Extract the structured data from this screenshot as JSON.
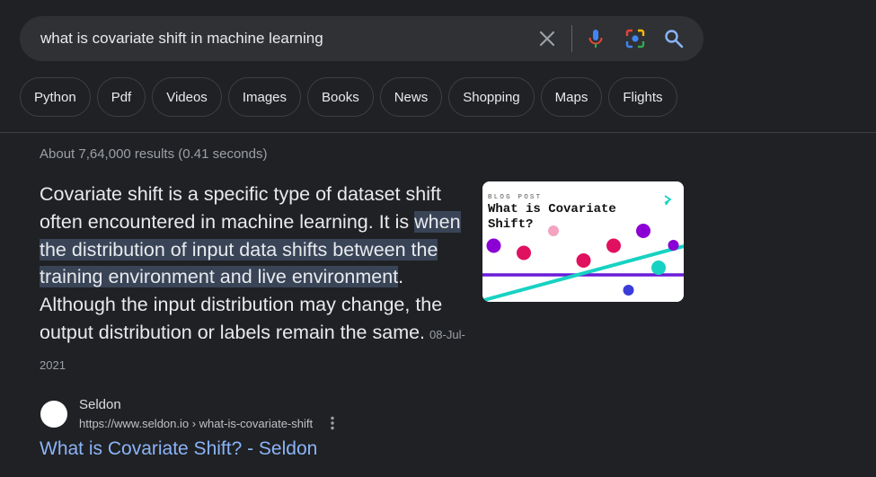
{
  "search": {
    "query": "what is covariate shift in machine learning",
    "icons": [
      "close-icon",
      "microphone-icon",
      "lens-icon",
      "search-icon"
    ]
  },
  "chips": [
    "Python",
    "Pdf",
    "Videos",
    "Images",
    "Books",
    "News",
    "Shopping",
    "Maps",
    "Flights"
  ],
  "stats": "About 7,64,000 results (0.41 seconds)",
  "snippet": {
    "text_before": "Covariate shift is a specific type of dataset shift often encountered in machine learning. It is ",
    "highlight": "when the distribution of input data shifts between the training environment and live environment",
    "text_after": ". Although the input distribution may change, the output distribution or labels remain the same.",
    "date": "08-Jul-2021"
  },
  "thumbnail": {
    "kicker": "BLOG POST",
    "title_line1": "What is Covariate",
    "title_line2": "Shift?",
    "colors": {
      "magenta": "#e0115f",
      "purple": "#8b00d4",
      "teal": "#17d2c2",
      "pink": "#f4a3c0",
      "blue": "#3b3bd9",
      "bar": "#6a1bd8"
    }
  },
  "result": {
    "source_name": "Seldon",
    "url": "https://www.seldon.io › what-is-covariate-shift",
    "title": "What is Covariate Shift? - Seldon"
  },
  "colors": {
    "background": "#202124",
    "search_bg": "#303134",
    "link": "#8ab4f8",
    "highlight": "#394457"
  }
}
